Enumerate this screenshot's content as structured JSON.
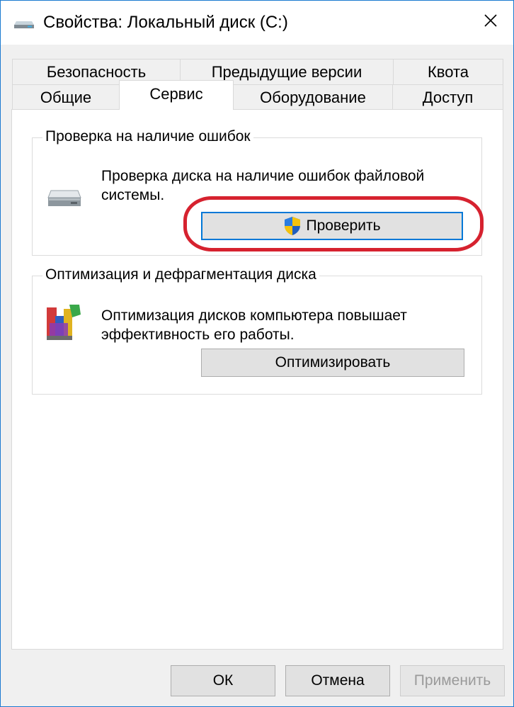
{
  "window": {
    "title": "Свойства: Локальный диск (C:)",
    "close_glyph": "✕"
  },
  "tabs": {
    "row1": [
      "Безопасность",
      "Предыдущие версии",
      "Квота"
    ],
    "row2": [
      "Общие",
      "Сервис",
      "Оборудование",
      "Доступ"
    ],
    "active": "Сервис"
  },
  "error_check": {
    "title": "Проверка на наличие ошибок",
    "description_line1": "Проверка диска на наличие ошибок файловой",
    "description_line2": "системы.",
    "button_label": "Проверить",
    "icon": "drive-icon"
  },
  "optimize": {
    "title": "Оптимизация и дефрагментация диска",
    "description_line1": "Оптимизация дисков компьютера повышает",
    "description_line2": "эффективность его работы.",
    "button_label": "Оптимизировать",
    "icon": "defrag-icon"
  },
  "footer": {
    "ok_label": "ОК",
    "cancel_label": "Отмена",
    "apply_label": "Применить"
  },
  "colors": {
    "highlight": "#d6222f",
    "focus": "#0078d7"
  }
}
